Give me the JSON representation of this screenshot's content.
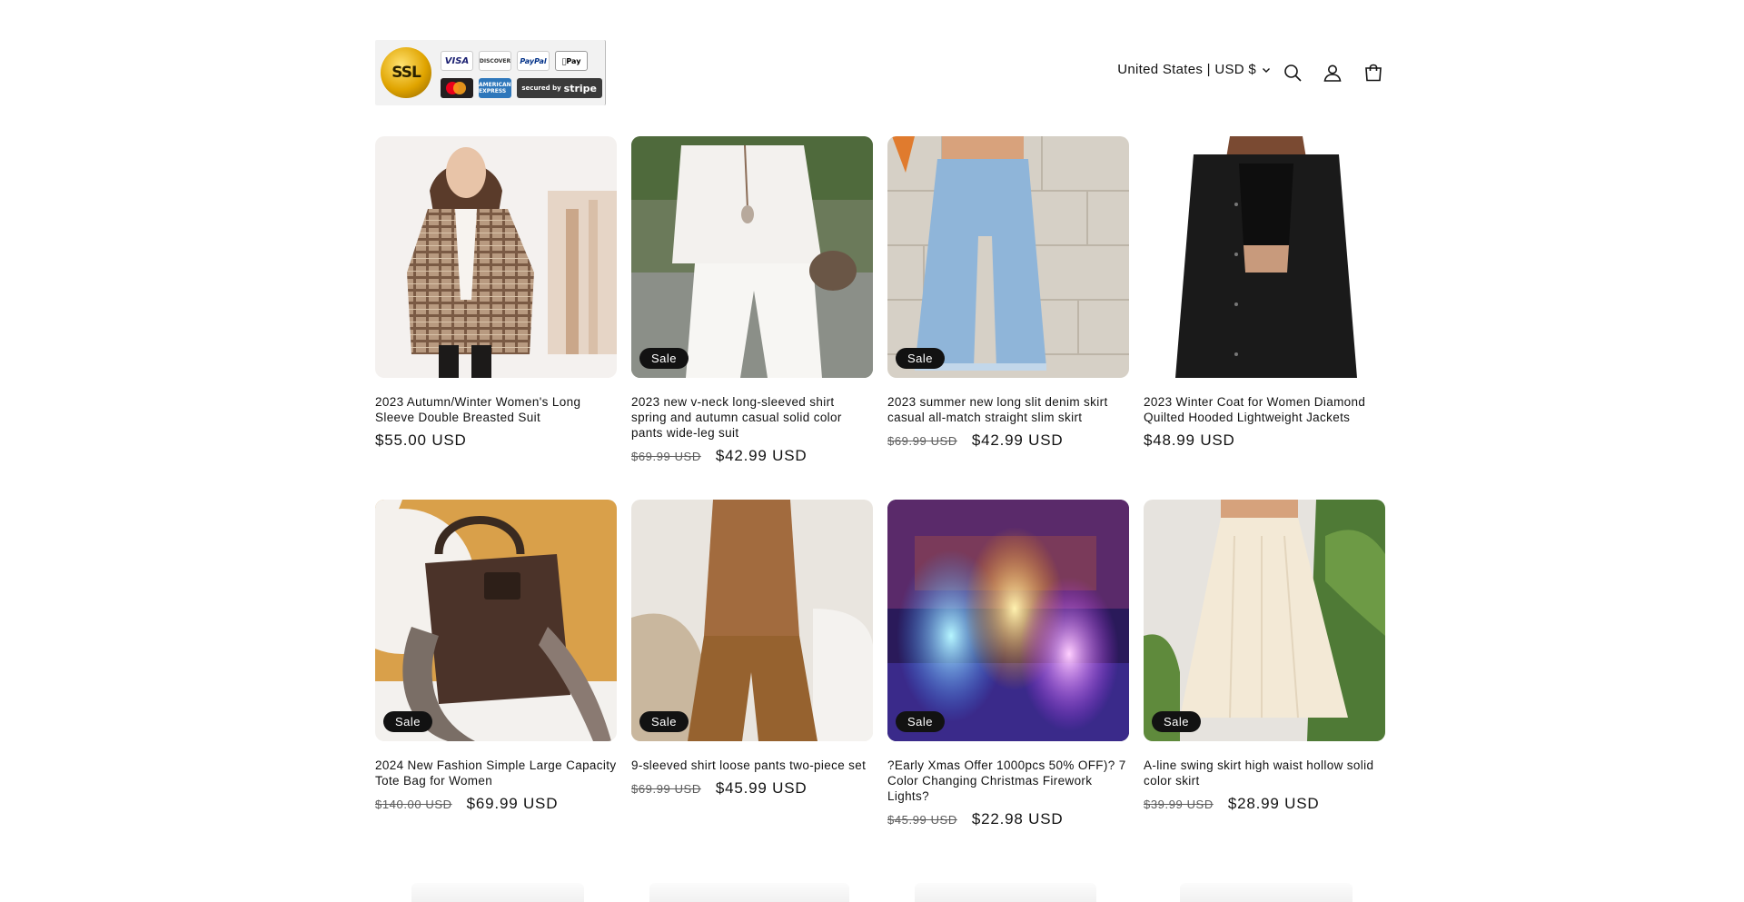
{
  "header": {
    "badge_text": {
      "seal": "SSL",
      "visa": "VISA",
      "discover": "DISCOVER",
      "paypal": "PayPal",
      "apple_pay": "Pay",
      "amex": "AMERICAN EXPRESS",
      "stripe_prefix": "secured by",
      "stripe": "stripe"
    },
    "locale": "United States | USD $",
    "icons": [
      "search-icon",
      "account-icon",
      "cart-icon"
    ]
  },
  "products": [
    {
      "title": "2023 Autumn/Winter Women's Long Sleeve Double Breasted Suit",
      "sale": "",
      "old_price": "",
      "price": "$55.00 USD"
    },
    {
      "title": "2023 new v-neck long-sleeved shirt spring and autumn casual solid color pants wide-leg suit",
      "sale": "Sale",
      "old_price": "$69.99 USD",
      "price": "$42.99 USD"
    },
    {
      "title": "2023 summer new long slit denim skirt casual all-match straight slim skirt",
      "sale": "Sale",
      "old_price": "$69.99 USD",
      "price": "$42.99 USD"
    },
    {
      "title": "2023 Winter Coat for Women Diamond Quilted Hooded Lightweight Jackets",
      "sale": "",
      "old_price": "",
      "price": "$48.99 USD"
    },
    {
      "title": "2024 New Fashion Simple Large Capacity Tote Bag for Women",
      "sale": "Sale",
      "old_price": "$140.00 USD",
      "price": "$69.99 USD"
    },
    {
      "title": "9-sleeved shirt loose pants two-piece set",
      "sale": "Sale",
      "old_price": "$69.99 USD",
      "price": "$45.99 USD"
    },
    {
      "title": "?Early Xmas Offer 1000pcs 50% OFF)? 7 Color Changing Christmas Firework Lights?",
      "sale": "Sale",
      "old_price": "$45.99 USD",
      "price": "$22.98 USD"
    },
    {
      "title": "A-line swing skirt high waist hollow solid color skirt",
      "sale": "Sale",
      "old_price": "$39.99 USD",
      "price": "$28.99 USD"
    }
  ]
}
